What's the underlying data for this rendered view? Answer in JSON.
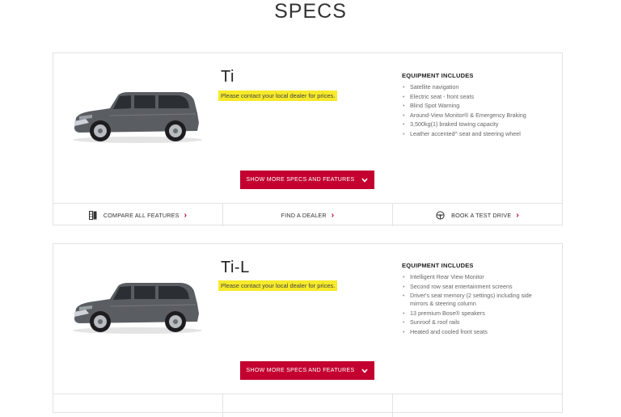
{
  "page": {
    "title": "SPECS"
  },
  "cards": [
    {
      "name": "Ti",
      "price_note": "Please contact your local dealer for prices.",
      "equipment_heading": "EQUIPMENT INCLUDES",
      "equipment": [
        "Satellite navigation",
        "Electric seat - front seats",
        "Blind Spot Warning",
        "Around-View Monitor® & Emergency Braking",
        "3,500kg(1) braked towing capacity",
        "Leather accented^ seat and steering wheel"
      ],
      "cta_label": "SHOW MORE SPECS AND FEATURES",
      "actions": {
        "compare": "COMPARE ALL FEATURES",
        "dealer": "FIND A DEALER",
        "test_drive": "BOOK A TEST DRIVE"
      }
    },
    {
      "name": "Ti-L",
      "price_note": "Please contact your local dealer for prices.",
      "equipment_heading": "EQUIPMENT INCLUDES",
      "equipment": [
        "Intelligent Rear View Monitor",
        "Second row seat entertainment screens",
        "Driver's seat memory (2 settings) including side mirrors & steering column",
        "13 premium Bose® speakers",
        "Sunroof & roof rails",
        "Heated and cooled front seats"
      ],
      "cta_label": "SHOW MORE SPECS AND FEATURES"
    }
  ],
  "colors": {
    "accent": "#c3002f",
    "highlight": "#f7ea2a",
    "border": "#e3e3e3"
  },
  "icons": [
    "compare-icon",
    "steering-wheel-icon",
    "chevron-right-icon",
    "chevron-down-icon"
  ]
}
